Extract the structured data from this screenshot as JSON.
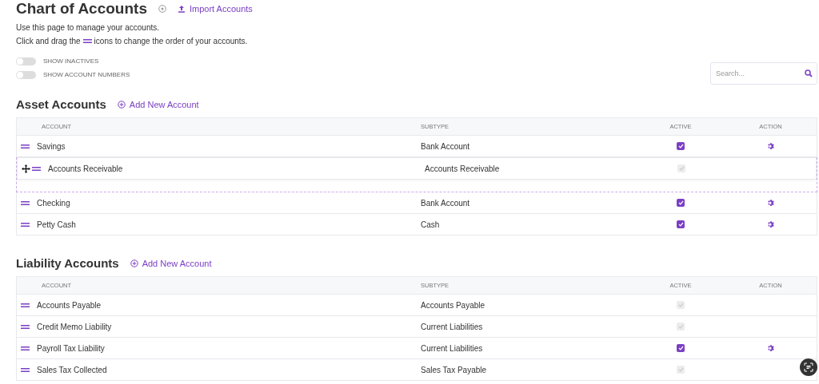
{
  "header": {
    "title": "Chart of Accounts",
    "import_link": "Import Accounts"
  },
  "intro": [
    "Use this page to manage your accounts.",
    {
      "before": "Click and drag the",
      "after": "icons to change the order of your accounts."
    }
  ],
  "toggles": [
    {
      "label": "SHOW INACTIVES",
      "on": false
    },
    {
      "label": "SHOW ACCOUNT NUMBERS",
      "on": false
    }
  ],
  "search": {
    "placeholder": "Search..."
  },
  "sections": [
    {
      "title": "Asset Accounts",
      "add_link": "Add New Account",
      "columns": [
        "ACCOUNT",
        "SUBTYPE",
        "ACTIVE",
        "ACTION"
      ],
      "rows": [
        {
          "account": "Savings",
          "subtype": "Bank Account",
          "active": true,
          "locked": false,
          "dragging": false
        },
        {
          "account": "Accounts Receivable",
          "subtype": "Accounts Receivable",
          "active": true,
          "locked": true,
          "dragging": true
        },
        {
          "account": "Checking",
          "subtype": "Bank Account",
          "active": true,
          "locked": false,
          "dragging": false
        },
        {
          "account": "Petty Cash",
          "subtype": "Cash",
          "active": true,
          "locked": false,
          "dragging": false
        }
      ]
    },
    {
      "title": "Liability Accounts",
      "add_link": "Add New Account",
      "columns": [
        "ACCOUNT",
        "SUBTYPE",
        "ACTIVE",
        "ACTION"
      ],
      "rows": [
        {
          "account": "Accounts Payable",
          "subtype": "Accounts Payable",
          "active": true,
          "locked": true,
          "dragging": false
        },
        {
          "account": "Credit Memo Liability",
          "subtype": "Current Liabilities",
          "active": true,
          "locked": true,
          "dragging": false
        },
        {
          "account": "Payroll Tax Liability",
          "subtype": "Current Liabilities",
          "active": true,
          "locked": false,
          "dragging": false
        },
        {
          "account": "Sales Tax Collected",
          "subtype": "Sales Tax Payable",
          "active": true,
          "locked": true,
          "dragging": false
        }
      ]
    }
  ]
}
